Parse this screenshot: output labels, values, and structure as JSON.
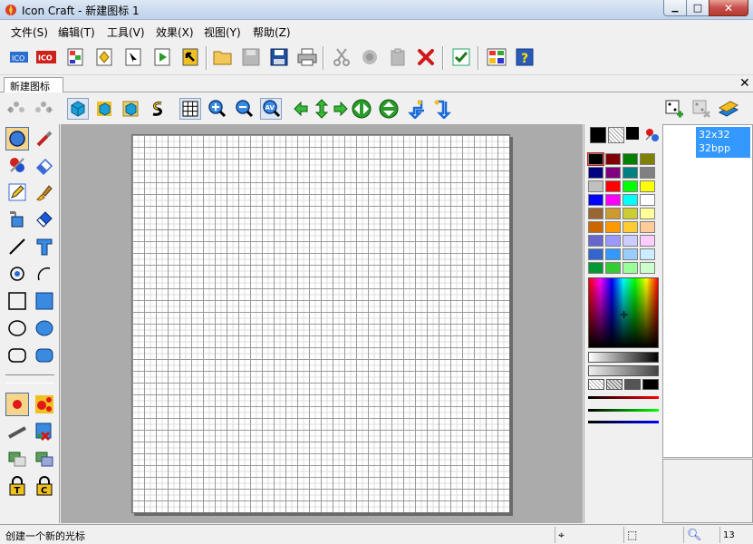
{
  "window": {
    "title": "Icon Craft - 新建图标 1",
    "minimize_glyph": "▁",
    "maximize_glyph": "□",
    "close_glyph": "✕"
  },
  "menu": {
    "items": [
      "文件(S)",
      "编辑(T)",
      "工具(V)",
      "效果(X)",
      "视图(Y)",
      "帮助(Z)"
    ]
  },
  "toolbar": {
    "ico_label": "ICO",
    "buttons": [
      "new-icon",
      "new-ico",
      "new-cursor",
      "new-image",
      "new-ani-cursor",
      "play",
      "export",
      "open",
      "save-disabled",
      "save",
      "print",
      "cut",
      "copy",
      "paste",
      "delete",
      "apply",
      "image-list",
      "help"
    ]
  },
  "tab": {
    "label": "新建图标 1",
    "close_glyph": "✕"
  },
  "toolbar2": {
    "zoom_label": "AV"
  },
  "format_panel": {
    "size": "32x32",
    "depth": "32bpp"
  },
  "palette": {
    "colors": [
      [
        "#000000",
        "#800000",
        "#008000",
        "#808000"
      ],
      [
        "#000080",
        "#800080",
        "#008080",
        "#808080"
      ],
      [
        "#c0c0c0",
        "#ff0000",
        "#00ff00",
        "#ffff00"
      ],
      [
        "#0000ff",
        "#ff00ff",
        "#00ffff",
        "#ffffff"
      ],
      [
        "#996633",
        "#cc9933",
        "#cccc33",
        "#ffff99"
      ],
      [
        "#cc6600",
        "#ff9900",
        "#ffcc33",
        "#ffcc99"
      ],
      [
        "#6666cc",
        "#9999ff",
        "#ccccff",
        "#ffccff"
      ],
      [
        "#3366cc",
        "#3399ff",
        "#99ccff",
        "#ccecff"
      ],
      [
        "#009933",
        "#33cc33",
        "#99ff99",
        "#ccffcc"
      ]
    ]
  },
  "status": {
    "text": "创建一个新的光标",
    "zoom": "13"
  }
}
